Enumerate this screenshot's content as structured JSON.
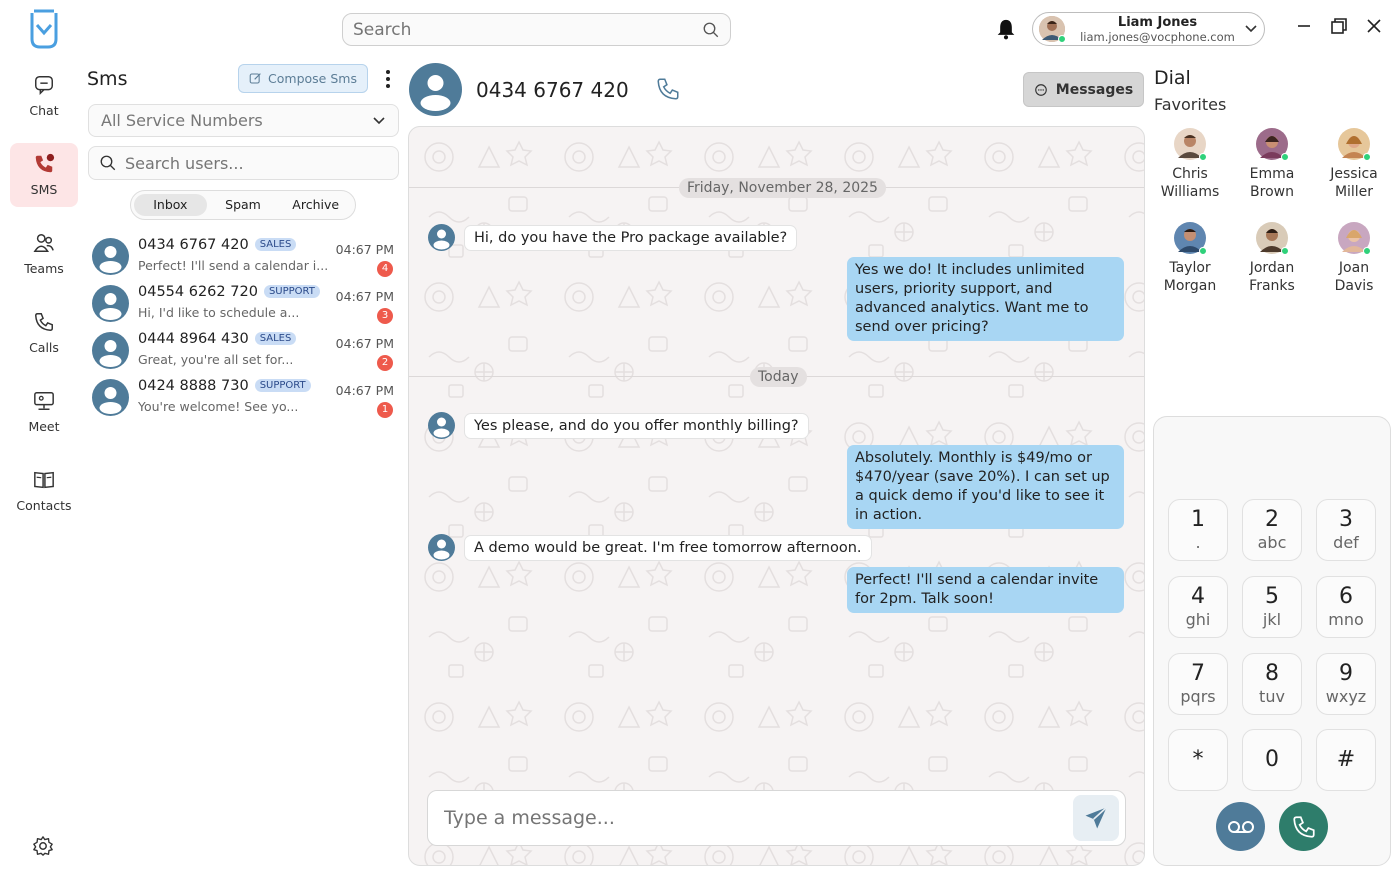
{
  "colors": {
    "accent": "#4f7b99",
    "active_rail": "#fde5e6",
    "bubble_out": "#a8d6f3",
    "badge_count": "#ee5a4c",
    "call": "#2e7d6b",
    "voicemail": "#4f7b99"
  },
  "topbar": {
    "search_placeholder": "Search",
    "search_icon": "search-icon",
    "profile": {
      "name": "Liam Jones",
      "email": "liam.jones@vocphone.com"
    }
  },
  "rail": {
    "items": [
      {
        "label": "Chat",
        "icon": "chat-icon"
      },
      {
        "label": "SMS",
        "icon": "sms-icon"
      },
      {
        "label": "Teams",
        "icon": "teams-icon"
      },
      {
        "label": "Calls",
        "icon": "phone-icon"
      },
      {
        "label": "Meet",
        "icon": "meet-icon"
      },
      {
        "label": "Contacts",
        "icon": "contacts-icon"
      }
    ]
  },
  "sms": {
    "title": "Sms",
    "compose_label": "Compose Sms",
    "service_select": "All Service Numbers",
    "search_placeholder": "Search users...",
    "tabs": [
      "Inbox",
      "Spam",
      "Archive"
    ],
    "conversations": [
      {
        "number": "0434 6767 420",
        "tag": "SALES",
        "preview": "Perfect! I'll send a calendar i...",
        "time": "04:67 PM",
        "count": "4"
      },
      {
        "number": "04554 6262 720",
        "tag": "SUPPORT",
        "preview": "Hi, I'd like to schedule a...",
        "time": "04:67 PM",
        "count": "3"
      },
      {
        "number": "0444 8964 430",
        "tag": "SALES",
        "preview": "Great, you're all set for...",
        "time": "04:67 PM",
        "count": "2"
      },
      {
        "number": "0424 8888 730",
        "tag": "SUPPORT",
        "preview": "You're welcome! See yo...",
        "time": "04:67 PM",
        "count": "1"
      }
    ]
  },
  "chat": {
    "number": "0434 6767 420",
    "messages_button": "Messages",
    "date1": "Friday, November 28, 2025",
    "date2": "Today",
    "messages": [
      {
        "dir": "in",
        "text": "Hi, do you have the Pro package available?"
      },
      {
        "dir": "out",
        "text": "Yes we do! It includes unlimited users, priority support, and advanced analytics. Want me to send over pricing?"
      },
      {
        "dir": "in",
        "text": "Yes please, and do you offer monthly billing?"
      },
      {
        "dir": "out",
        "text": "Absolutely. Monthly is $49/mo or $470/year (save 20%). I can set up a quick demo if you'd like to see it in action."
      },
      {
        "dir": "in",
        "text": "A demo would be great. I'm free tomorrow afternoon."
      },
      {
        "dir": "out",
        "text": "Perfect! I'll send a calendar invite for 2pm. Talk soon!"
      }
    ],
    "composer_placeholder": "Type a message..."
  },
  "dial": {
    "title": "Dial",
    "favorites_title": "Favorites",
    "favorites": [
      {
        "first": "Chris",
        "last": "Williams"
      },
      {
        "first": "Emma",
        "last": "Brown"
      },
      {
        "first": "Jessica",
        "last": "Miller"
      },
      {
        "first": "Taylor",
        "last": "Morgan"
      },
      {
        "first": "Jordan",
        "last": "Franks"
      },
      {
        "first": "Joan",
        "last": "Davis"
      }
    ],
    "keys": [
      {
        "d": "1",
        "l": "."
      },
      {
        "d": "2",
        "l": "abc"
      },
      {
        "d": "3",
        "l": "def"
      },
      {
        "d": "4",
        "l": "ghi"
      },
      {
        "d": "5",
        "l": "jkl"
      },
      {
        "d": "6",
        "l": "mno"
      },
      {
        "d": "7",
        "l": "pqrs"
      },
      {
        "d": "8",
        "l": "tuv"
      },
      {
        "d": "9",
        "l": "wxyz"
      },
      {
        "d": "*",
        "l": ""
      },
      {
        "d": "0",
        "l": ""
      },
      {
        "d": "#",
        "l": ""
      }
    ]
  }
}
